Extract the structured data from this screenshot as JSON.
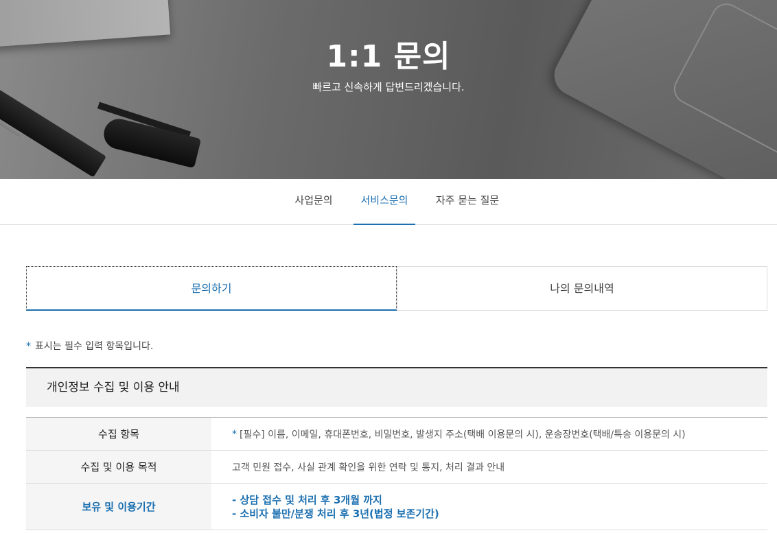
{
  "hero": {
    "title": "1:1 문의",
    "subtitle": "빠르고 신속하게 답변드리겠습니다."
  },
  "top_tabs": [
    {
      "label": "사업문의",
      "active": false
    },
    {
      "label": "서비스문의",
      "active": true
    },
    {
      "label": "자주 묻는 질문",
      "active": false
    }
  ],
  "inquiry_tabs": [
    {
      "label": "문의하기",
      "active": true
    },
    {
      "label": "나의 문의내역",
      "active": false
    }
  ],
  "required_note": {
    "star": "*",
    "text": "표시는 필수 입력 항목입니다."
  },
  "privacy": {
    "heading": "개인정보 수집 및 이용 안내",
    "rows": [
      {
        "label": "수집 항목",
        "star": "*",
        "value": "[필수] 이름, 이메일, 휴대폰번호, 비밀번호, 발생지 주소(택배 이용문의 시), 운송장번호(택배/특송 이용문의 시)"
      },
      {
        "label": "수집 및 이용 목적",
        "value": "고객 민원 접수, 사실 관계 확인을 위한 연락 및 통지, 처리 결과 안내"
      },
      {
        "label": "보유 및 이용기간",
        "lines": [
          "- 상담 접수 및 처리 후 3개월 까지",
          "- 소비자 불만/분쟁 처리 후 3년(법정 보존기간)"
        ]
      }
    ]
  },
  "colors": {
    "accent": "#1a6fb0",
    "header_bg": "#f2f2f2",
    "label_bg": "#f5f5f5"
  }
}
